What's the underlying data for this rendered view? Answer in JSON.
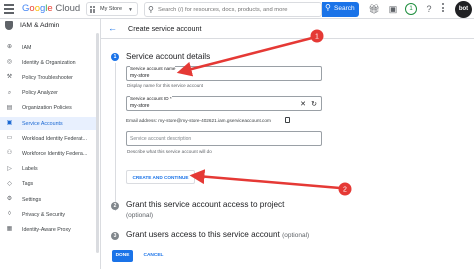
{
  "topbar": {
    "logo_google": [
      "G",
      "o",
      "o",
      "g",
      "l",
      "e"
    ],
    "logo_cloud": "Cloud",
    "project": "My Store",
    "search_placeholder": "Search (/) for resources, docs, products, and more",
    "search_button": "Search",
    "notification_count": "1",
    "avatar_text": "bot"
  },
  "sidebar": {
    "title": "IAM & Admin",
    "items": [
      {
        "label": "IAM",
        "icon": "person-add-icon",
        "glyph": "⊕"
      },
      {
        "label": "Identity & Organization",
        "icon": "person-circle-icon",
        "glyph": "◎"
      },
      {
        "label": "Policy Troubleshooter",
        "icon": "wrench-icon",
        "glyph": "⚒"
      },
      {
        "label": "Policy Analyzer",
        "icon": "search-doc-icon",
        "glyph": "⌕"
      },
      {
        "label": "Organization Policies",
        "icon": "doc-icon",
        "glyph": "▤"
      },
      {
        "label": "Service Accounts",
        "icon": "service-account-icon",
        "glyph": "▣",
        "active": true
      },
      {
        "label": "Workload Identity Federat...",
        "icon": "id-card-icon",
        "glyph": "▭"
      },
      {
        "label": "Workforce Identity Federa...",
        "icon": "people-icon",
        "glyph": "⚇"
      },
      {
        "label": "Labels",
        "icon": "label-icon",
        "glyph": "▷"
      },
      {
        "label": "Tags",
        "icon": "tag-icon",
        "glyph": "◇"
      },
      {
        "label": "Settings",
        "icon": "settings-icon",
        "glyph": "⚙"
      },
      {
        "label": "Privacy & Security",
        "icon": "shield-icon",
        "glyph": "◊"
      },
      {
        "label": "Identity-Aware Proxy",
        "icon": "proxy-icon",
        "glyph": "▦"
      }
    ]
  },
  "main": {
    "page_title": "Create service account",
    "step1": {
      "number": "1",
      "title": "Service account details",
      "name_label": "Service account name",
      "name_value": "my-store",
      "name_helper": "Display name for this service account",
      "id_label": "Service account ID *",
      "id_value": "my-store",
      "email_text": "Email address: my-store@my-store-402621.iam.gserviceaccount.com",
      "desc_placeholder": "Service account description",
      "desc_helper": "Describe what this service account will do",
      "create_button": "CREATE AND CONTINUE"
    },
    "step2": {
      "number": "2",
      "title": "Grant this service account access to project",
      "optional": "(optional)"
    },
    "step3": {
      "number": "3",
      "title": "Grant users access to this service account",
      "optional": "(optional)"
    },
    "done_button": "DONE",
    "cancel_button": "CANCEL"
  },
  "annotations": [
    {
      "number": "1"
    },
    {
      "number": "2"
    }
  ],
  "colors": {
    "accent": "#1a73e8",
    "annotation": "#e53935",
    "active_bg": "#e8f0fe"
  }
}
